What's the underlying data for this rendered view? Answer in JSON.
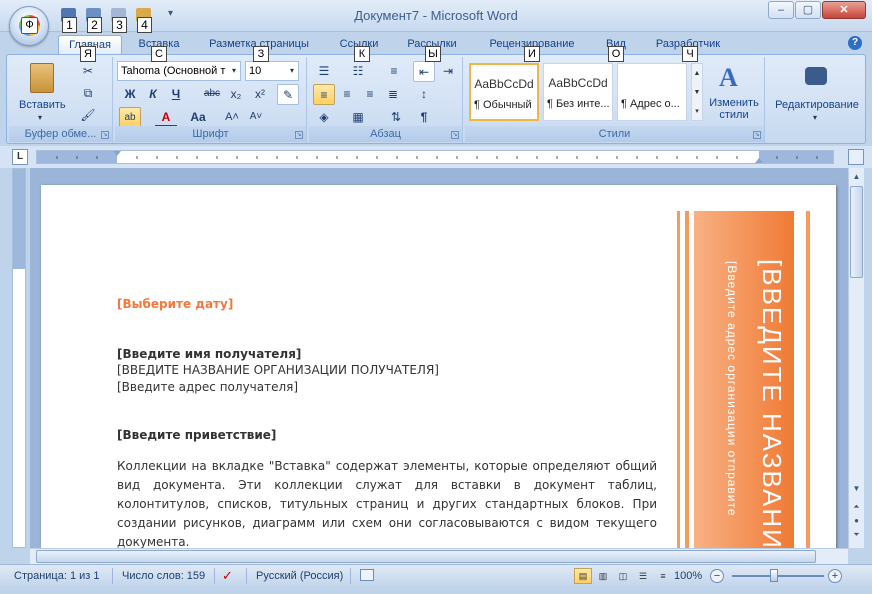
{
  "window": {
    "title": "Документ7 - Microsoft Word",
    "controls": [
      "–",
      "▢",
      "✕"
    ]
  },
  "office_button": {
    "keytip": "Ф"
  },
  "quick_access": {
    "keytips": [
      "1",
      "2",
      "3",
      "4"
    ],
    "more": "▾"
  },
  "tabs": [
    {
      "label": "Главная",
      "keytip": "Я"
    },
    {
      "label": "Вставка",
      "keytip": "С"
    },
    {
      "label": "Разметка страницы",
      "keytip": "З"
    },
    {
      "label": "Ссылки",
      "keytip": "К"
    },
    {
      "label": "Рассылки",
      "keytip": "Ы"
    },
    {
      "label": "Рецензирование",
      "keytip": "И"
    },
    {
      "label": "Вид",
      "keytip": "О"
    },
    {
      "label": "Разработчик",
      "keytip": "Ч"
    }
  ],
  "ribbon": {
    "clipboard": {
      "label": "Буфер обме...",
      "paste": "Вставить"
    },
    "font": {
      "label": "Шрифт",
      "font_name": "Tahoma (Основной т",
      "font_size": "10",
      "bold": "Ж",
      "italic": "К",
      "underline": "Ч",
      "strike": "abc",
      "subscript": "x₂",
      "superscript": "x²",
      "grow": "A˄",
      "shrink": "A˅",
      "case": "Aa",
      "highlight": "ab",
      "color": "A"
    },
    "paragraph": {
      "label": "Абзац",
      "pilcrow": "¶"
    },
    "styles": {
      "label": "Стили",
      "items": [
        {
          "sample": "AaBbCcDd",
          "name": "¶ Обычный"
        },
        {
          "sample": "AaBbCcDd",
          "name": "¶ Без инте..."
        },
        {
          "sample": "",
          "name": "¶ Адрес о..."
        }
      ],
      "change": "Изменить стили"
    },
    "editing": {
      "label": "Редактирование"
    }
  },
  "ruler": {
    "corner": "L"
  },
  "document": {
    "date": "[Выберите дату]",
    "recipient_name": "[Введите имя получателя]",
    "recipient_org": "[ВВЕДИТЕ НАЗВАНИЕ ОРГАНИЗАЦИИ ПОЛУЧАТЕЛЯ]",
    "recipient_address": "[Введите адрес получателя]",
    "greeting": "[Введите приветствие]",
    "body": "Коллекции на вкладке \"Вставка\" содержат элементы, которые определяют общий вид документа. Эти коллекции служат для вставки в документ таблиц, колонтитулов, списков, титульных страниц и других стандартных блоков. При создании рисунков, диаграмм или схем они согласовываются с видом текущего документа.",
    "sidebar_title": "[ВВЕДИТЕ НАЗВАНИ",
    "sidebar_address": "[Введите адрес организации отправите"
  },
  "status": {
    "page": "Страница: 1 из 1",
    "words": "Число слов: 159",
    "language": "Русский (Россия)",
    "zoom": "100%"
  },
  "colors": {
    "accent_orange": "#f2793b",
    "ribbon_blue": "#d2e1f4",
    "text_blue": "#15428b"
  }
}
